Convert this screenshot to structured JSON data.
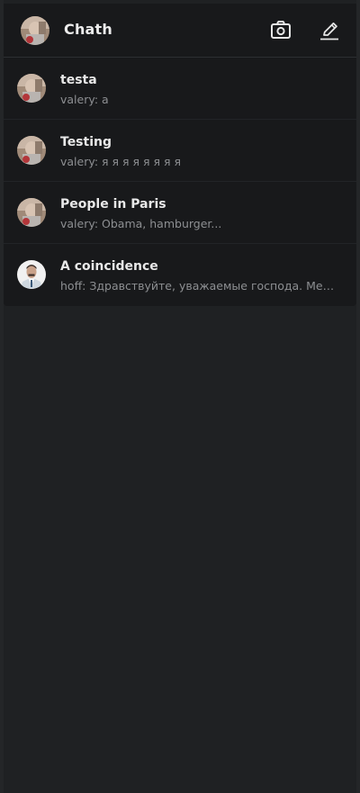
{
  "header": {
    "title": "Chath",
    "avatar_icon": "user-avatar-icon",
    "camera_icon": "camera-icon",
    "compose_icon": "pencil-icon"
  },
  "conversations": [
    {
      "name": "testa",
      "preview": "valery: a",
      "avatar": "user-avatar"
    },
    {
      "name": "Testing",
      "preview": "valery: я я я я я я я я",
      "avatar": "user-avatar"
    },
    {
      "name": "People in Paris",
      "preview": "valery: Obama, hamburger...",
      "avatar": "user-avatar"
    },
    {
      "name": "A coincidence",
      "preview": "hoff: Здравствуйте, уважаемые господа. Меня зо...",
      "avatar": "portrait-avatar"
    }
  ],
  "colors": {
    "background": "#1f2123",
    "panel": "#18191b",
    "text_primary": "#e8e8e8",
    "text_secondary": "#8d8f92"
  }
}
